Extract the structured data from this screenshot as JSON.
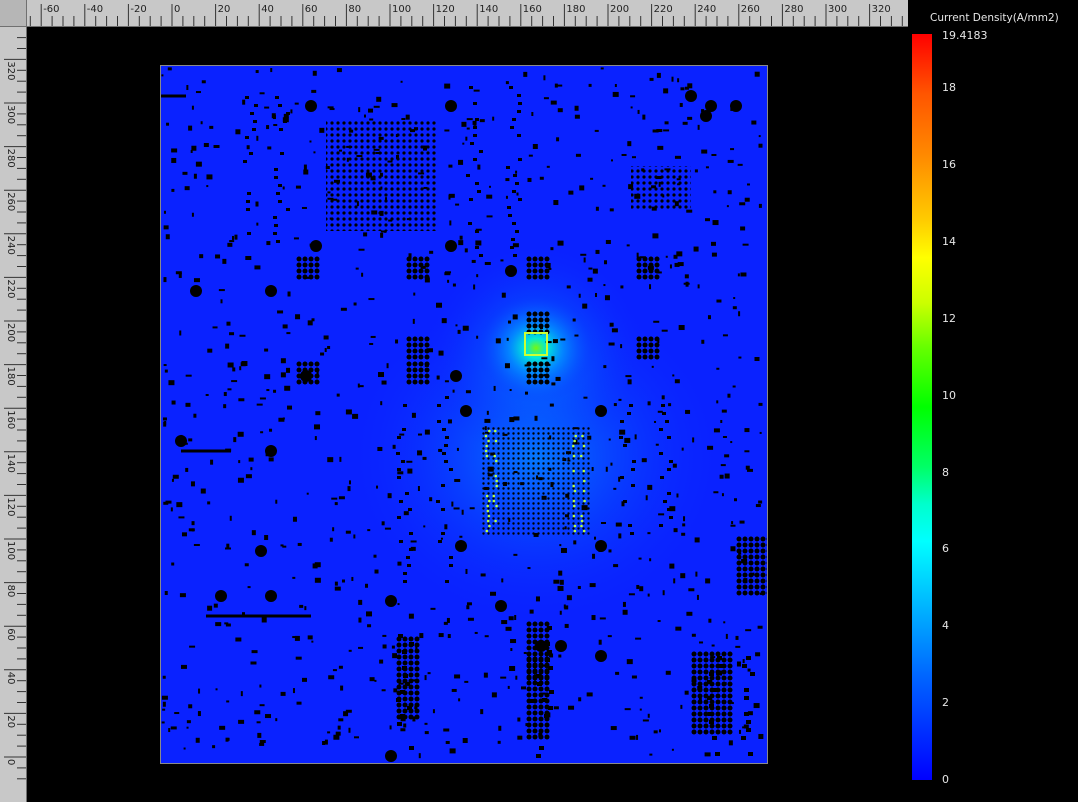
{
  "window": {
    "view": "pcb-current-density-plot"
  },
  "ruler": {
    "top_labels": [
      "-60",
      "-40",
      "-20",
      "0",
      "20",
      "40",
      "60",
      "80",
      "100",
      "120",
      "140",
      "160",
      "180",
      "200",
      "220",
      "240",
      "260",
      "280",
      "300",
      "320"
    ],
    "left_labels": [
      "320",
      "300",
      "280",
      "260",
      "240",
      "220",
      "200",
      "180",
      "160",
      "140",
      "120",
      "100",
      "80",
      "60",
      "40",
      "20",
      "0"
    ]
  },
  "legend": {
    "title": "Current Density(A/mm2)",
    "max_label": "19.4183",
    "ticks": [
      "18",
      "16",
      "14",
      "12",
      "10",
      "8",
      "6",
      "4",
      "2",
      "0"
    ],
    "colors": {
      "max": "#ff0000",
      "mid": "#00ff00",
      "min": "#0000ff"
    }
  },
  "board": {
    "background_color": "#0a22ff",
    "hotspot_color": "#22ccff",
    "hotspot_peak_color": "#7cff00"
  }
}
